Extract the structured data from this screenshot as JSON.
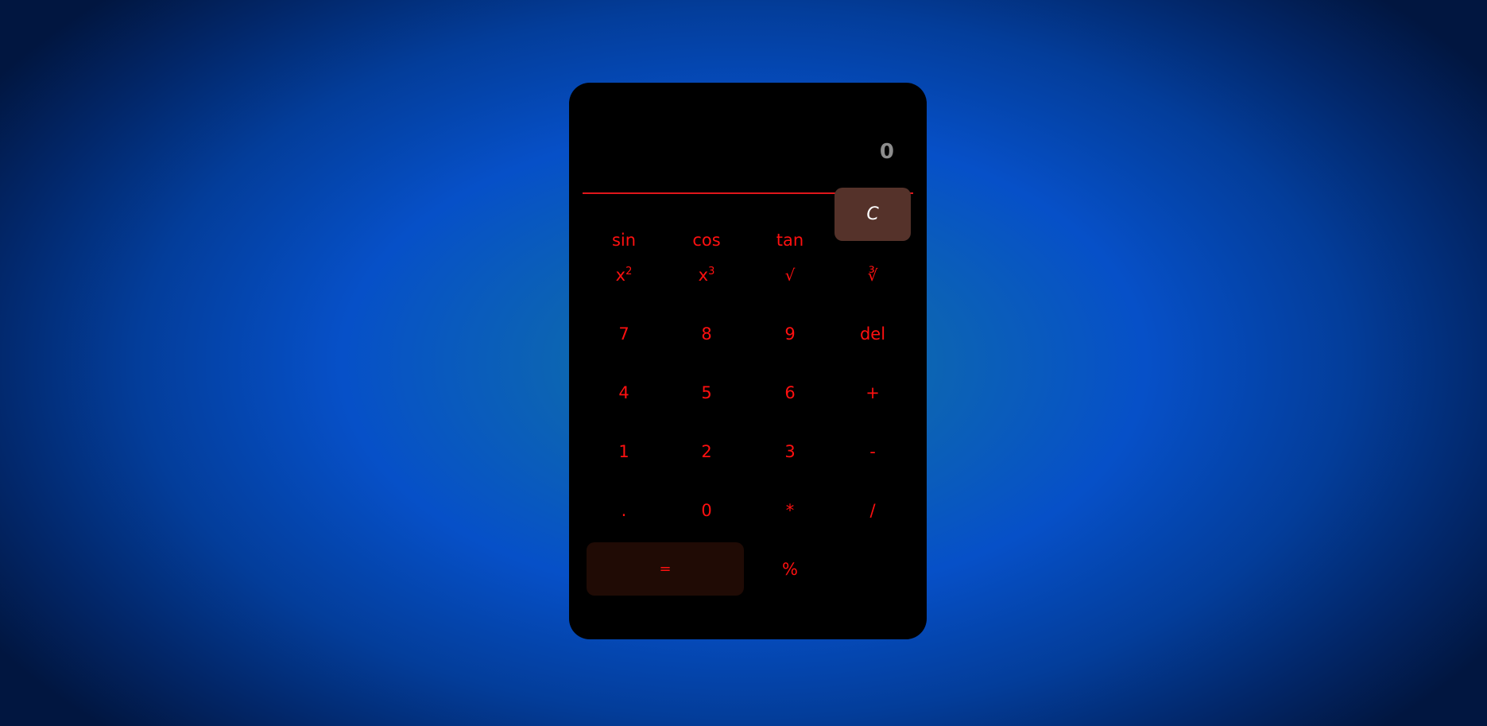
{
  "display": {
    "value": "0"
  },
  "keys": {
    "sin": "sin",
    "cos": "cos",
    "tan": "tan",
    "clear": "C",
    "square_base": "x",
    "square_exp": "2",
    "cube_base": "x",
    "cube_exp": "3",
    "sqrt": "√",
    "cbrt": "∛",
    "seven": "7",
    "eight": "8",
    "nine": "9",
    "del": "del",
    "four": "4",
    "five": "5",
    "six": "6",
    "plus": "+",
    "one": "1",
    "two": "2",
    "three": "3",
    "minus": "-",
    "dot": ".",
    "zero": "0",
    "multiply": "*",
    "divide": "/",
    "equals": "=",
    "percent": "%"
  },
  "colors": {
    "key_text": "#ff1010",
    "clear_bg": "#55322a",
    "equals_bg": "#200b05",
    "divider": "#e0161b",
    "display_text": "#8c8c8c"
  }
}
